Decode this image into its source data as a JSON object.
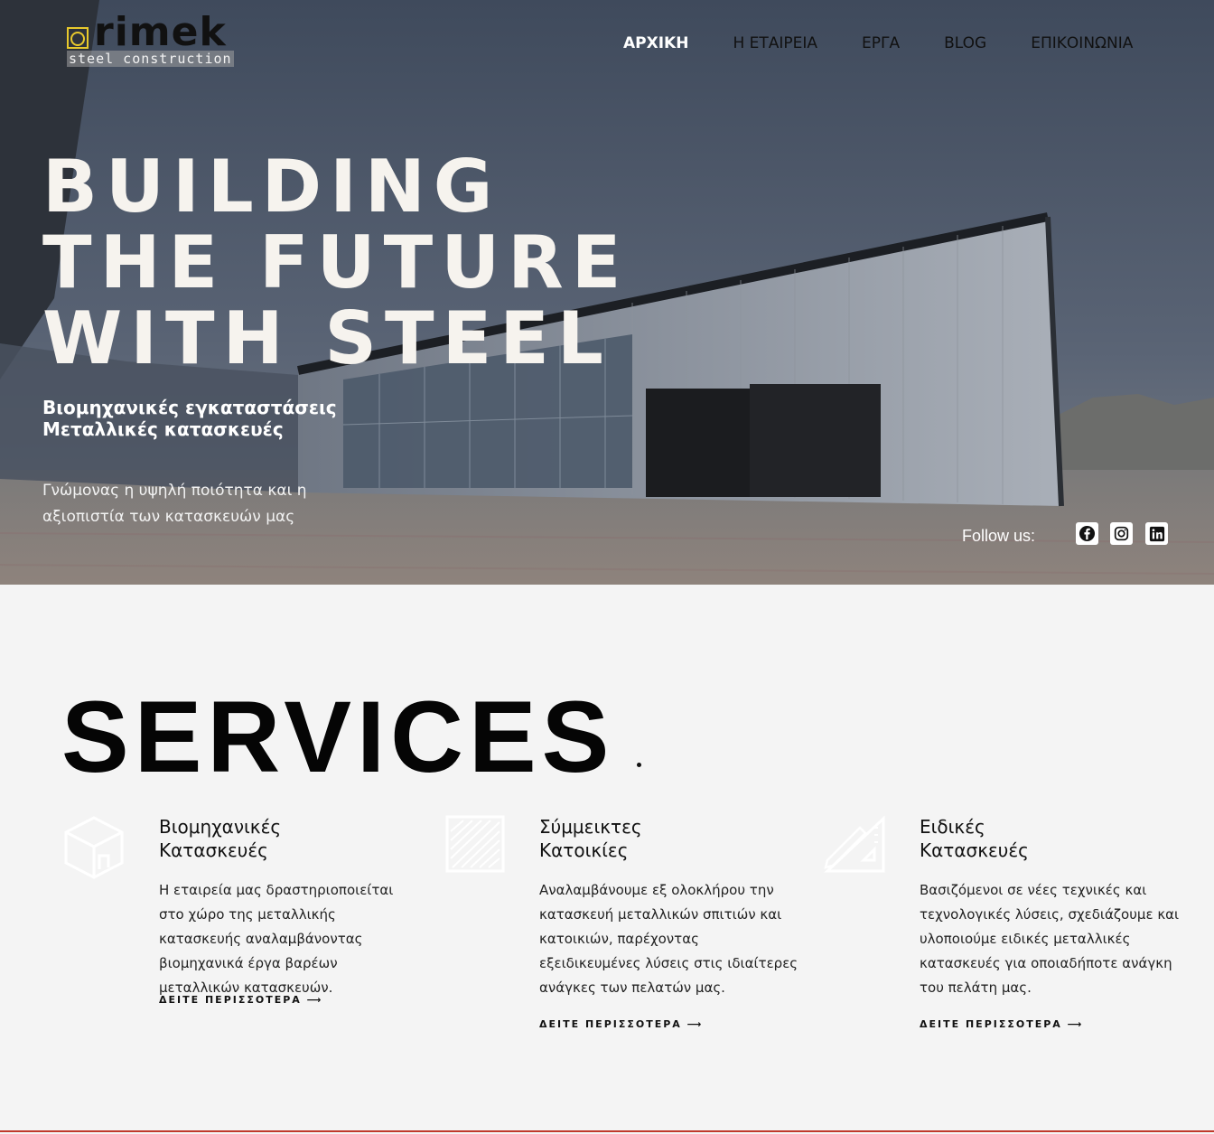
{
  "brand": {
    "logo_word": "rimek",
    "logo_tag": "steel construction",
    "accent_color": "#e8c92c"
  },
  "nav": {
    "items": [
      {
        "label": "ΑΡΧΙΚΗ",
        "active": true
      },
      {
        "label": "Η ΕΤΑΙΡΕΙΑ",
        "active": false
      },
      {
        "label": "ΕΡΓΑ",
        "active": false
      },
      {
        "label": "BLOG",
        "active": false
      },
      {
        "label": "ΕΠΙΚΟΙΝΩΝΙΑ",
        "active": false
      }
    ]
  },
  "hero": {
    "headline": [
      "BUILDING",
      "THE FUTURE",
      "WITH STEEL"
    ],
    "subhead": [
      "Βιομηχανικές εγκαταστάσεις",
      "Μεταλλικές κατασκευές"
    ],
    "tagline": "Γνώμονας η υψηλή ποιότητα και η αξιοπιστία των κατασκευών μας",
    "follow_label": "Follow us:",
    "social": [
      "facebook-icon",
      "instagram-icon",
      "linkedin-icon"
    ]
  },
  "services": {
    "title": "SERVICES",
    "items": [
      {
        "icon": "box-icon",
        "title": [
          "Βιομηχανικές",
          "Κατασκευές"
        ],
        "text": "Η εταιρεία μας δραστηριοποιείται στο χώρο της μεταλλικής κατασκευής αναλαμβάνοντας βιομηχανικά έργα βαρέων μεταλλικών κατασκευών.",
        "more": "ΔΕΙΤΕ ΠΕΡΙΣΣΟΤΕΡΑ ⟶"
      },
      {
        "icon": "hatched-square-icon",
        "title": [
          "Σύμμεικτες",
          "Κατοικίες"
        ],
        "text": "Αναλαμβάνουμε εξ ολοκλήρου την κατασκευή μεταλλικών σπιτιών και κατοικιών, παρέχοντας εξειδικευμένες λύσεις στις ιδιαίτερες ανάγκες των πελατών μας.",
        "more": "ΔΕΙΤΕ ΠΕΡΙΣΣΟΤΕΡΑ ⟶"
      },
      {
        "icon": "ruler-pencil-icon",
        "title": [
          "Ειδικές",
          "Κατασκευές"
        ],
        "text": "Βασιζόμενοι σε νέες τεχνικές και τεχνολογικές λύσεις, σχεδιάζουμε και υλοποιούμε ειδικές μεταλλικές κατασκευές για οποιαδήποτε ανάγκη του πελάτη μας.",
        "more": "ΔΕΙΤΕ ΠΕΡΙΣΣΟΤΕΡΑ ⟶"
      }
    ]
  }
}
